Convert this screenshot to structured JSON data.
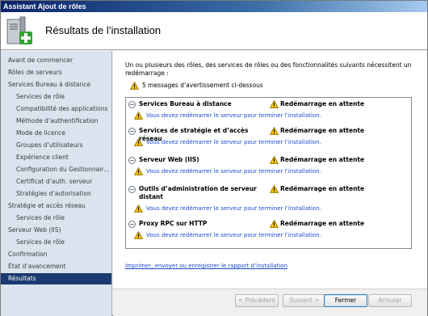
{
  "window": {
    "title": "Assistant Ajout de rôles"
  },
  "header": {
    "title": "Résultats de l’installation",
    "icon": "server-add-icon"
  },
  "sidebar": {
    "items": [
      {
        "label": "Avant de commencer",
        "level": 0,
        "active": false
      },
      {
        "label": "Rôles de serveurs",
        "level": 0,
        "active": false
      },
      {
        "label": "Services Bureau à distance",
        "level": 0,
        "active": false
      },
      {
        "label": "Services de rôle",
        "level": 1,
        "active": false
      },
      {
        "label": "Compatibilité des applications",
        "level": 1,
        "active": false
      },
      {
        "label": "Méthode d’authentification",
        "level": 1,
        "active": false
      },
      {
        "label": "Mode de licence",
        "level": 1,
        "active": false
      },
      {
        "label": "Groupes d’utilisateurs",
        "level": 1,
        "active": false
      },
      {
        "label": "Expérience client",
        "level": 1,
        "active": false
      },
      {
        "label": "Configuration du Gestionnaire ...",
        "level": 1,
        "active": false
      },
      {
        "label": "Certificat d’auth. serveur",
        "level": 1,
        "active": false
      },
      {
        "label": "Stratégies d’autorisation",
        "level": 1,
        "active": false
      },
      {
        "label": "Stratégie et accès réseau",
        "level": 0,
        "active": false
      },
      {
        "label": "Services de rôle",
        "level": 1,
        "active": false
      },
      {
        "label": "Serveur Web (IIS)",
        "level": 0,
        "active": false
      },
      {
        "label": "Services de rôle",
        "level": 1,
        "active": false
      },
      {
        "label": "Confirmation",
        "level": 0,
        "active": false
      },
      {
        "label": "État d’avancement",
        "level": 0,
        "active": false
      },
      {
        "label": "Résultats",
        "level": 0,
        "active": true
      }
    ]
  },
  "content": {
    "intro": "Un ou plusieurs des rôles, des services de rôles ou des fonctionnalités suivants nécessitent un redémarrage :",
    "warning_summary": "5 messages d’avertissement ci-dessous",
    "results": [
      {
        "name": "Services Bureau à distance",
        "status": "Redémarrage en attente",
        "message": "Vous devez redémarrer le serveur pour terminer l’installation."
      },
      {
        "name": "Services de stratégie et d’accès réseau",
        "status": "Redémarrage en attente",
        "message": "Vous devez redémarrer le serveur pour terminer l’installation."
      },
      {
        "name": "Serveur Web (IIS)",
        "status": "Redémarrage en attente",
        "message": "Vous devez redémarrer le serveur pour terminer l’installation."
      },
      {
        "name": "Outils d’administration de serveur distant",
        "status": "Redémarrage en attente",
        "message": "Vous devez redémarrer le serveur pour terminer l’installation."
      },
      {
        "name": "Proxy RPC sur HTTP",
        "status": "Redémarrage en attente",
        "message": "Vous devez redémarrer le serveur pour terminer l’installation."
      }
    ],
    "report_link": "Imprimer, envoyer ou enregistrer le rapport d’installation"
  },
  "footer": {
    "previous": "< Précédent",
    "next": "Suivant >",
    "close": "Fermer",
    "cancel": "Annuler"
  },
  "colors": {
    "active_nav": "#1b3a6f",
    "sidebar_bg": "#dbe4ee",
    "link": "#1a4bd1",
    "warning": "#f2c200"
  }
}
